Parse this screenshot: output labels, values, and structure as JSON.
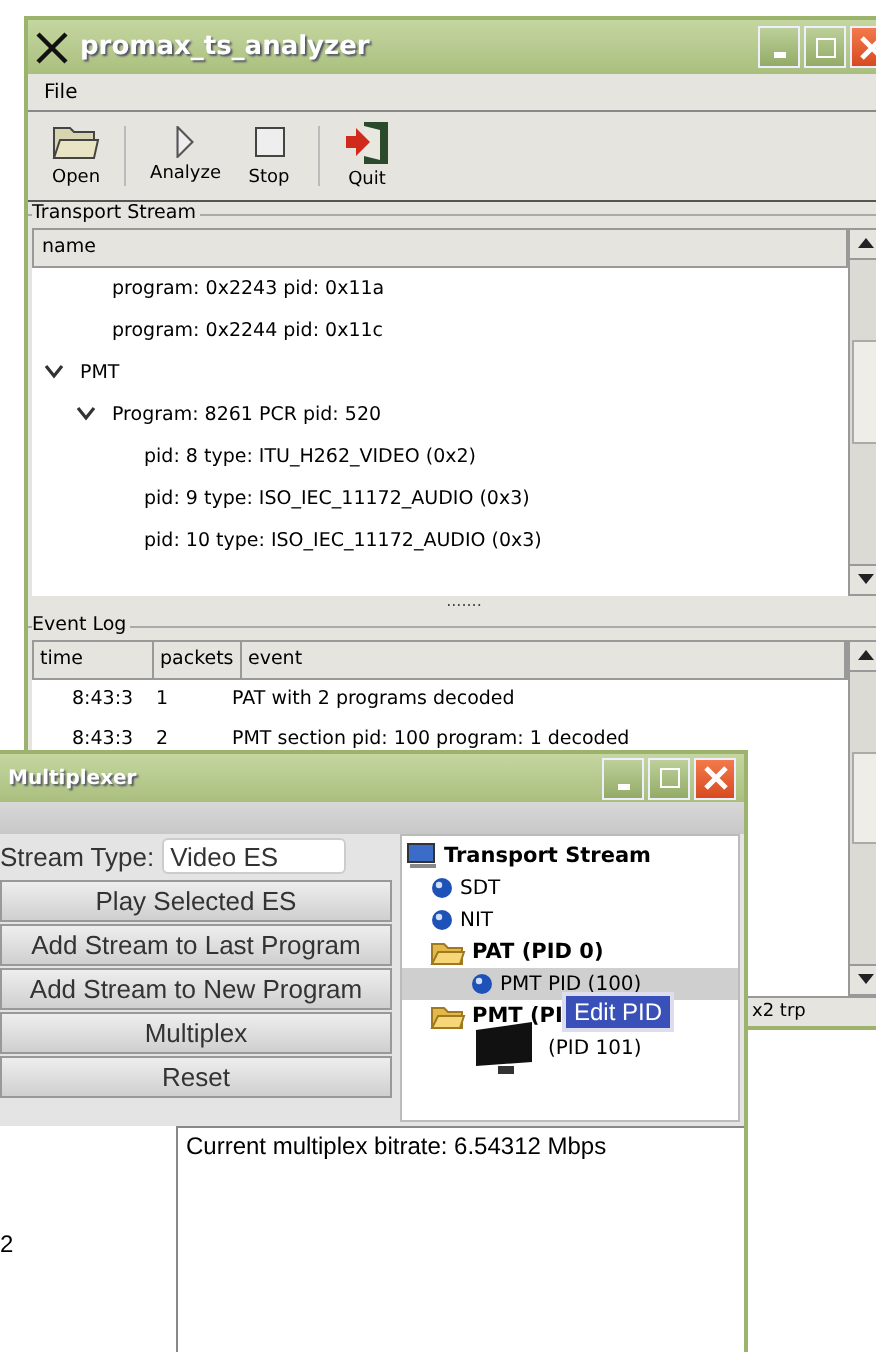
{
  "analyzer": {
    "title": "promax_ts_analyzer",
    "menu": [
      {
        "label": "File"
      }
    ],
    "toolbar": [
      {
        "label": "Open",
        "kind": "open"
      },
      {
        "label": "Analyze",
        "kind": "play"
      },
      {
        "label": "Stop",
        "kind": "stop"
      },
      {
        "label": "Quit",
        "kind": "quit"
      }
    ],
    "stream_tree": {
      "label": "Transport Stream",
      "column": "name",
      "items": [
        {
          "children": [
            {
              "label": "program: 0x2243 pid: 0x11a"
            },
            {
              "label": "program: 0x2244 pid: 0x11c"
            }
          ]
        },
        {
          "label": "PMT",
          "expanded": true,
          "children": [
            {
              "label": "Program: 8261 PCR pid: 520",
              "expanded": true,
              "children": [
                {
                  "label": "pid: 8 type: ITU_H262_VIDEO (0x2)"
                },
                {
                  "label": "pid: 9 type: ISO_IEC_11172_AUDIO (0x3)"
                },
                {
                  "label": "pid: 10 type: ISO_IEC_11172_AUDIO (0x3)"
                }
              ]
            }
          ]
        }
      ]
    },
    "splitter": ".......",
    "event_log": {
      "label": "Event Log",
      "columns": [
        "time",
        "packets",
        "event"
      ],
      "rows": [
        {
          "time": "8:43:3",
          "packets": "1",
          "event": "PAT with 2 programs decoded"
        },
        {
          "time": "8:43:3",
          "packets": "2",
          "event": "PMT section pid: 100 program: 1 decoded"
        }
      ]
    },
    "status": "x2 trp"
  },
  "multiplexer": {
    "title": "Multiplexer",
    "stream_type": {
      "label": "Stream Type:",
      "value": "Video ES"
    },
    "buttons": [
      "Play Selected ES",
      "Add Stream to Last Program",
      "Add Stream to New Program",
      "Multiplex",
      "Reset"
    ],
    "tree": {
      "label": "Transport Stream",
      "kind": "root",
      "children": [
        {
          "label": "SDT",
          "kind": "table",
          "selected": false
        },
        {
          "label": "NIT",
          "kind": "table",
          "selected": false
        },
        {
          "label": "PAT (PID 0)",
          "kind": "folder",
          "selected": false,
          "children": [
            {
              "label": "PMT PID (100)",
              "kind": "table",
              "selected": true
            }
          ]
        },
        {
          "label": "PMT (PI",
          "kind": "folder",
          "selected": false,
          "children": [
            {
              "label": "(PID 101)",
              "kind": "screen",
              "selected": false
            }
          ]
        }
      ]
    },
    "tooltip": "Edit PID",
    "left_text": "2",
    "output": "Current multiplex bitrate: 6.54312 Mbps"
  }
}
